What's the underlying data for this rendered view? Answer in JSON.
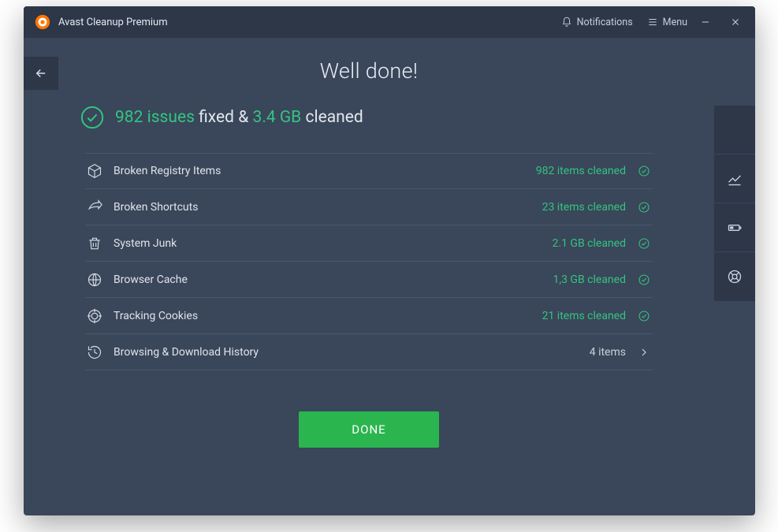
{
  "colors": {
    "accent": "#33c481",
    "button": "#2bb54f",
    "bg": "#3a4659",
    "panel": "#2d3748"
  },
  "titlebar": {
    "app_title": "Avast Cleanup Premium",
    "notifications_label": "Notifications",
    "menu_label": "Menu"
  },
  "page": {
    "title": "Well done!",
    "summary": {
      "issues_count": "982 issues",
      "fixed_word": "fixed",
      "amp": "&",
      "size": "3.4 GB",
      "cleaned_word": "cleaned"
    },
    "done_label": "DONE"
  },
  "rows": [
    {
      "icon": "cube",
      "label": "Broken Registry Items",
      "result": "982 items cleaned",
      "status": "ok"
    },
    {
      "icon": "share",
      "label": "Broken Shortcuts",
      "result": "23 items cleaned",
      "status": "ok"
    },
    {
      "icon": "trash",
      "label": "System Junk",
      "result": "2.1 GB cleaned",
      "status": "ok"
    },
    {
      "icon": "globe",
      "label": "Browser Cache",
      "result": "1,3 GB cleaned",
      "status": "ok"
    },
    {
      "icon": "target",
      "label": "Tracking Cookies",
      "result": "21 items cleaned",
      "status": "ok"
    },
    {
      "icon": "history",
      "label": "Browsing & Download History",
      "result": "4 items",
      "status": "more"
    }
  ],
  "rail": {
    "items": [
      "grid",
      "chart",
      "battery",
      "lifebuoy"
    ]
  }
}
